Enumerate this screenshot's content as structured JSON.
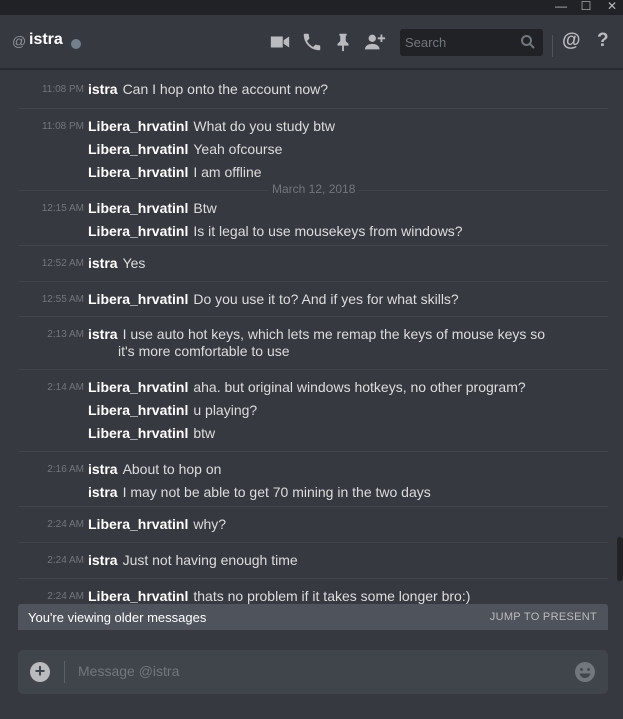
{
  "window": {
    "minimize_glyph": "—",
    "maximize_glyph": "☐",
    "close_glyph": "✕"
  },
  "header": {
    "at_symbol": "@",
    "username": "istra",
    "status_color": "#747f8d",
    "icons": [
      "video-call-icon",
      "voice-call-icon",
      "pin-icon",
      "add-friend-icon",
      "mention-icon",
      "help-icon"
    ],
    "search_placeholder": "Search",
    "mention_glyph": "@",
    "help_glyph": "?"
  },
  "date_divider": "March 12, 2018",
  "groups": [
    {
      "time": "11:08 PM",
      "lines": [
        {
          "author": "istra",
          "text": "Can I hop onto the account now?"
        }
      ]
    },
    {
      "time": "11:08 PM",
      "lines": [
        {
          "author": "Libera_hrvatinl",
          "text": "What do you study btw"
        },
        {
          "author": "Libera_hrvatinl",
          "text": "Yeah ofcourse"
        },
        {
          "author": "Libera_hrvatinl",
          "text": "I am offline"
        }
      ]
    },
    {
      "time": "12:15 AM",
      "lines": [
        {
          "author": "Libera_hrvatinl",
          "text": "Btw"
        },
        {
          "author": "Libera_hrvatinl",
          "text": "Is it legal to use mousekeys from windows?"
        }
      ]
    },
    {
      "time": "12:52 AM",
      "lines": [
        {
          "author": "istra",
          "text": "Yes"
        }
      ]
    },
    {
      "time": "12:55 AM",
      "lines": [
        {
          "author": "Libera_hrvatinl",
          "text": "Do you use it to? And if yes for what skills?"
        }
      ]
    },
    {
      "time": "2:13 AM",
      "lines": [
        {
          "author": "istra",
          "text": "I use auto hot keys, which lets me remap the keys of mouse keys so"
        },
        {
          "author": "",
          "text": "it's more comfortable to use"
        }
      ]
    },
    {
      "time": "2:14 AM",
      "lines": [
        {
          "author": "Libera_hrvatinl",
          "text": "aha. but original windows hotkeys, no other program?"
        },
        {
          "author": "Libera_hrvatinl",
          "text": "u playing?"
        },
        {
          "author": "Libera_hrvatinl",
          "text": "btw"
        }
      ]
    },
    {
      "time": "2:16 AM",
      "lines": [
        {
          "author": "istra",
          "text": "About to hop on"
        },
        {
          "author": "istra",
          "text": "I may not be able to get 70 mining in the two days"
        }
      ]
    },
    {
      "time": "2:24 AM",
      "lines": [
        {
          "author": "Libera_hrvatinl",
          "text": "why?"
        }
      ]
    },
    {
      "time": "2:24 AM",
      "lines": [
        {
          "author": "istra",
          "text": "Just not having enough time"
        }
      ]
    },
    {
      "time": "2:24 AM",
      "lines": [
        {
          "author": "Libera_hrvatinl",
          "text": "thats no problem if it takes some longer bro:)"
        }
      ]
    }
  ],
  "older_bar": {
    "text": "You're viewing older messages",
    "jump_label": "JUMP TO PRESENT"
  },
  "composer": {
    "placeholder": "Message @istra",
    "plus_glyph": "+"
  }
}
